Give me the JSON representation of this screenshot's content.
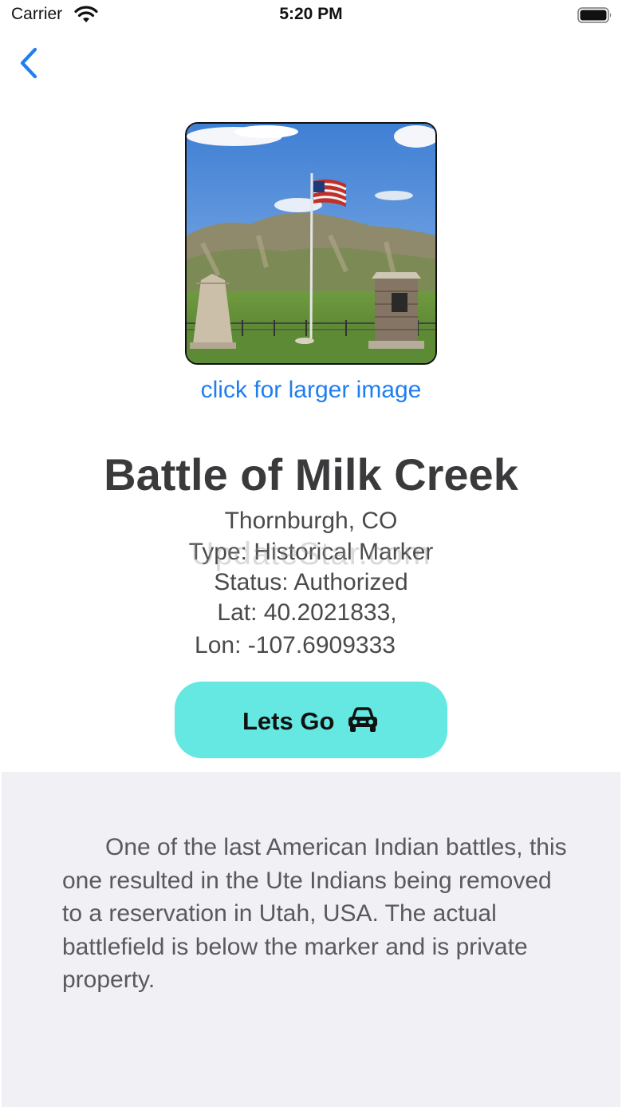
{
  "status_bar": {
    "carrier": "Carrier",
    "time": "5:20 PM"
  },
  "photo": {
    "link_text": "click for larger image"
  },
  "marker": {
    "title": "Battle of Milk Creek",
    "location": "Thornburgh, CO",
    "type": "Type: Historical Marker",
    "status": "Status: Authorized",
    "lat": "Lat: 40.2021833,",
    "lon": "Lon: -107.6909333"
  },
  "watermark": "UpdateStar.com",
  "actions": {
    "go_label": "Lets Go",
    "go_icon": "car-icon"
  },
  "description": "One of the last American Indian battles, this one resulted in the Ute Indians being removed to a reservation in Utah, USA. The actual battlefield is below the marker and is private property.",
  "colors": {
    "accent": "#1f7ff0",
    "button": "#65e8e2",
    "panel": "#f0f0f5"
  }
}
